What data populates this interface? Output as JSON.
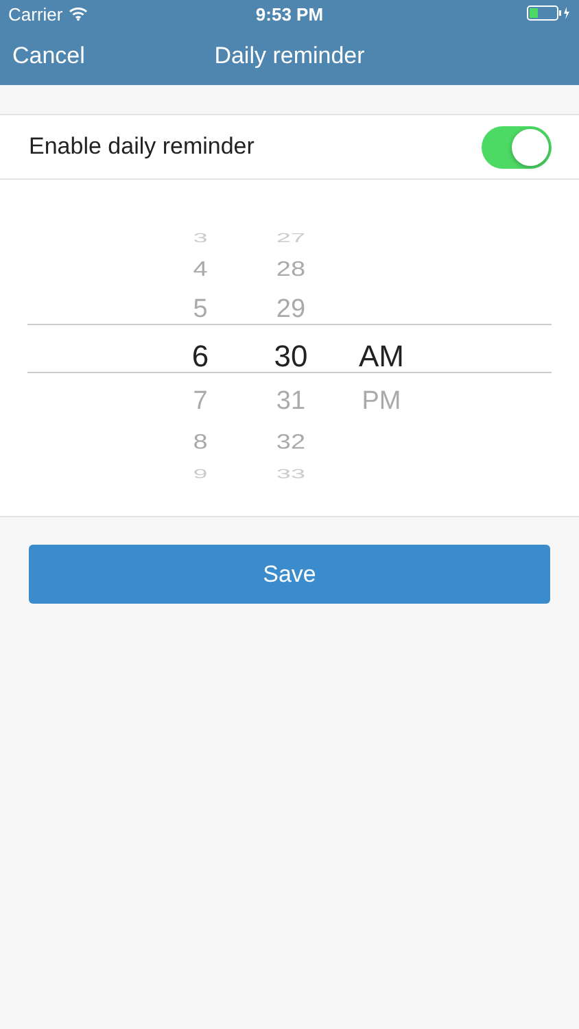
{
  "status_bar": {
    "carrier": "Carrier",
    "time": "9:53 PM"
  },
  "nav": {
    "cancel": "Cancel",
    "title": "Daily reminder"
  },
  "reminder": {
    "label": "Enable daily reminder",
    "on": true
  },
  "picker": {
    "wheels": [
      {
        "items": [
          {
            "label": "3",
            "selected": false
          },
          {
            "label": "4",
            "selected": false
          },
          {
            "label": "5",
            "selected": false
          },
          {
            "label": "6",
            "selected": true
          },
          {
            "label": "7",
            "selected": false
          },
          {
            "label": "8",
            "selected": false
          },
          {
            "label": "9",
            "selected": false
          }
        ]
      },
      {
        "items": [
          {
            "label": "27",
            "selected": false
          },
          {
            "label": "28",
            "selected": false
          },
          {
            "label": "29",
            "selected": false
          },
          {
            "label": "30",
            "selected": true
          },
          {
            "label": "31",
            "selected": false
          },
          {
            "label": "32",
            "selected": false
          },
          {
            "label": "33",
            "selected": false
          }
        ]
      },
      {
        "items": [
          {
            "label": "AM",
            "selected": true
          },
          {
            "label": "PM",
            "selected": false
          }
        ]
      }
    ]
  },
  "save_button": "Save"
}
